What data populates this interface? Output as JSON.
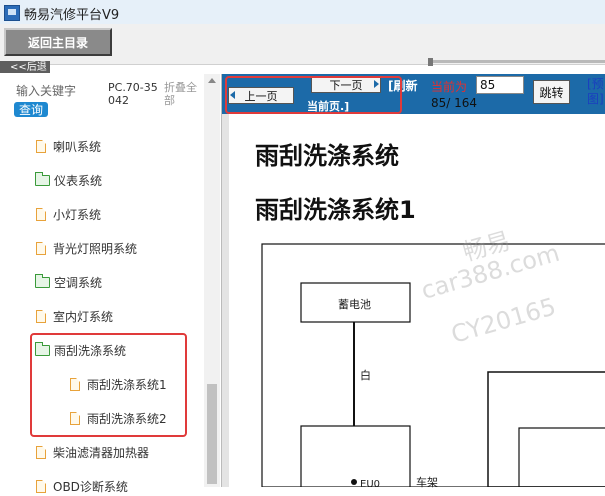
{
  "window": {
    "title": "畅易汽修平台V9"
  },
  "toolbar": {
    "home_label": "返回主目录",
    "back_label": "<<后退"
  },
  "search": {
    "label": "输入关键字",
    "query_label": "查询",
    "model_code": "PC.70-35042",
    "collapse_label": "折叠全部"
  },
  "tree": {
    "items": [
      {
        "label": "喇叭系统",
        "icon": "document-icon"
      },
      {
        "label": "仪表系统",
        "icon": "folder-icon"
      },
      {
        "label": "小灯系统",
        "icon": "document-icon"
      },
      {
        "label": "背光灯照明系统",
        "icon": "document-icon"
      },
      {
        "label": "空调系统",
        "icon": "folder-icon"
      },
      {
        "label": "室内灯系统",
        "icon": "document-icon"
      },
      {
        "label": "雨刮洗涤系统",
        "icon": "folder-open-icon"
      },
      {
        "label": "雨刮洗涤系统1",
        "icon": "document-icon"
      },
      {
        "label": "雨刮洗涤系统2",
        "icon": "document-icon"
      },
      {
        "label": "柴油滤清器加热器",
        "icon": "document-icon"
      },
      {
        "label": "OBD诊断系统",
        "icon": "document-icon"
      }
    ]
  },
  "viewer": {
    "prev_label": "上一页",
    "next_label": "下一页",
    "current_page_link": "当前页.]",
    "refresh_label": "[刷新",
    "current_label": "当前为",
    "page_input": "85",
    "page_count": "85/ 164",
    "jump_label": "跳转",
    "preview_label": "[预图]"
  },
  "document": {
    "heading": "雨刮洗涤系统",
    "subheading": "雨刮洗涤系统1",
    "battery_label": "蓄电池",
    "wire_color": "白",
    "ground_label": "车架",
    "short_text": "EU0",
    "watermark": [
      "畅易",
      "car388.com",
      "CY20165"
    ]
  },
  "colors": {
    "accent": "#1c6aa8",
    "highlight": "#e03a3a",
    "link": "#1a3fbf",
    "current_label": "#e23030"
  }
}
